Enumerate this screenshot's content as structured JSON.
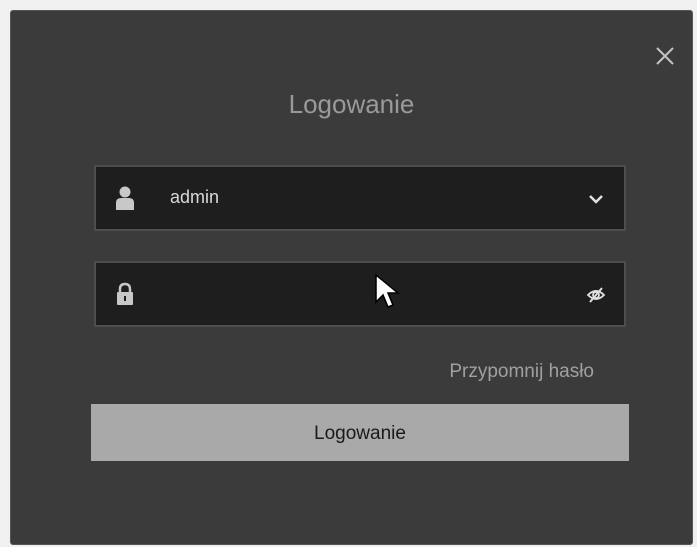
{
  "dialog": {
    "title": "Logowanie",
    "close_icon": "close-icon"
  },
  "username": {
    "icon": "user-icon",
    "value": "admin",
    "dropdown_icon": "chevron-down-icon"
  },
  "password": {
    "icon": "lock-icon",
    "value": "",
    "visibility_icon": "eye-off-icon"
  },
  "forgot_password": {
    "label": "Przypomnij hasło"
  },
  "login_button": {
    "label": "Logowanie"
  },
  "colors": {
    "dialog_bg": "#3b3b3b",
    "field_bg": "#1e1e1e",
    "button_bg": "#a9a9a9"
  }
}
